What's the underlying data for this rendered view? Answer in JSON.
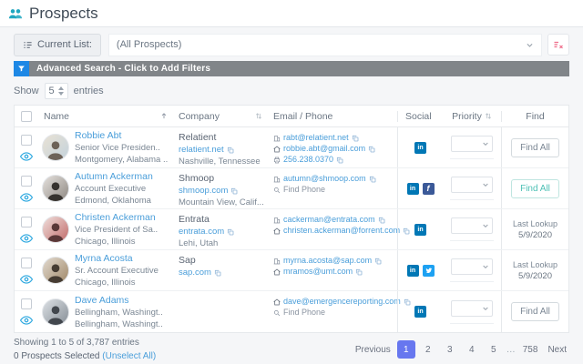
{
  "header": {
    "title": "Prospects"
  },
  "toolbar": {
    "current_list_label": "Current List:",
    "selected_list": "(All Prospects)"
  },
  "advanced_search_label": "Advanced Search - Click to Add Filters",
  "show_entries": {
    "show": "Show",
    "count": "5",
    "entries": "entries"
  },
  "icons": {
    "linkedin": "in",
    "facebook": "f"
  },
  "table": {
    "headers": {
      "name": "Name",
      "company": "Company",
      "email_phone": "Email / Phone",
      "social": "Social",
      "priority": "Priority",
      "find": "Find"
    },
    "find_all_label": "Find All",
    "find_phone_label": "Find Phone",
    "last_lookup_label": "Last Lookup",
    "rows": [
      {
        "name": "Robbie Abt",
        "job_title": "Senior Vice Presiden..",
        "location": "Montgomery, Alabama ..",
        "company": "Relatient",
        "company_url": "relatient.net",
        "company_location": "Nashville, Tennessee",
        "work_email": "rabt@relatient.net",
        "home_email": "robbie.abt@gmail.com",
        "phone": "256.238.0370",
        "social": [
          "linkedin"
        ]
      },
      {
        "name": "Autumn Ackerman",
        "job_title": "Account Executive",
        "location": "Edmond, Oklahoma",
        "company": "Shmoop",
        "company_url": "shmoop.com",
        "company_location": "Mountain View, Calif...",
        "work_email": "autumn@shmoop.com",
        "social": [
          "linkedin",
          "facebook"
        ]
      },
      {
        "name": "Christen Ackerman",
        "job_title": "Vice President of Sa..",
        "location": "Chicago, Illinois",
        "company": "Entrata",
        "company_url": "entrata.com",
        "company_location": "Lehi, Utah",
        "work_email": "cackerman@entrata.com",
        "home_email": "christen.ackerman@forrent.com",
        "social": [
          "linkedin"
        ],
        "last_lookup_date": "5/9/2020"
      },
      {
        "name": "Myrna Acosta",
        "job_title": "Sr. Account Executive",
        "location": "Chicago, Illinois",
        "company": "Sap",
        "company_url": "sap.com",
        "work_email": "myrna.acosta@sap.com",
        "home_email": "mramos@umt.com",
        "social": [
          "linkedin",
          "twitter"
        ],
        "last_lookup_date": "5/9/2020"
      },
      {
        "name": "Dave Adams",
        "job_title": "Bellingham, Washingt..",
        "location": "Bellingham, Washingt..",
        "home_email": "dave@emergencereporting.com",
        "social": [
          "linkedin"
        ]
      }
    ]
  },
  "footer": {
    "showing": "Showing 1 to 5 of 3,787 entries",
    "selected": "0 Prospects Selected",
    "unselect_all": "(Unselect All)"
  },
  "pagination": {
    "previous": "Previous",
    "pages": [
      "1",
      "2",
      "3",
      "4",
      "5",
      "…",
      "758"
    ],
    "next": "Next",
    "active_page": "1"
  },
  "colors": {
    "link_blue": "#4a9eda",
    "active_page_bg": "#6777ef",
    "linkedin": "#0077b5",
    "facebook": "#3b5998",
    "twitter": "#1da1f2",
    "advanced_bar": "#818589",
    "advanced_icon": "#1e88e5"
  }
}
